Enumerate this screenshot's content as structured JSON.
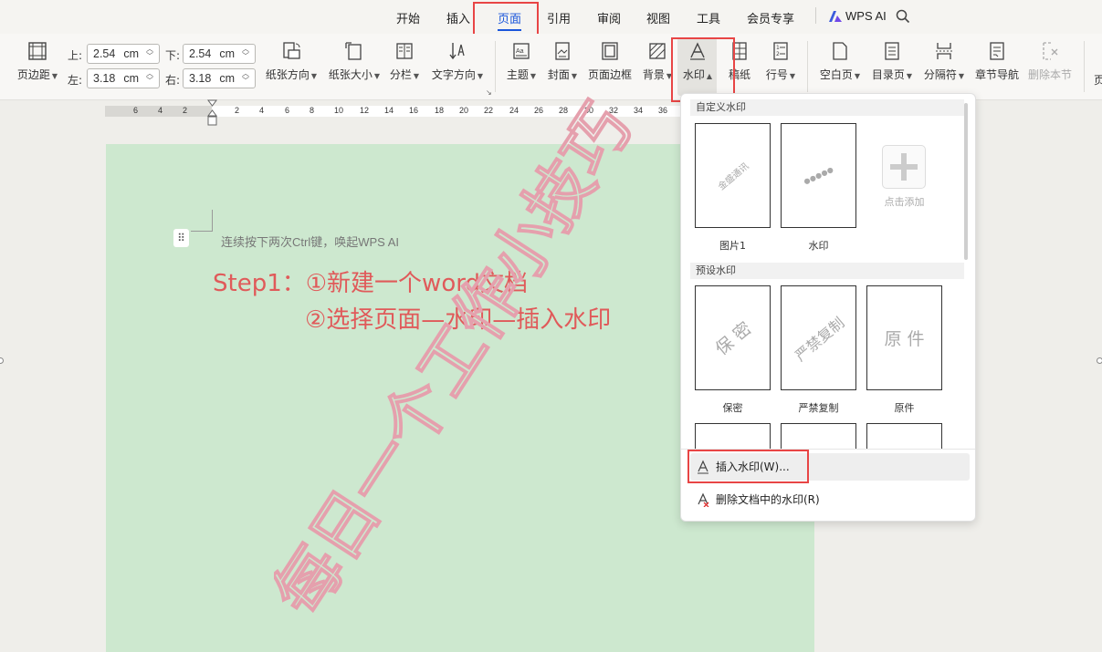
{
  "menubar": {
    "tabs": [
      {
        "label": "开始"
      },
      {
        "label": "插入"
      },
      {
        "label": "页面"
      },
      {
        "label": "引用"
      },
      {
        "label": "审阅"
      },
      {
        "label": "视图"
      },
      {
        "label": "工具"
      },
      {
        "label": "会员专享"
      }
    ],
    "active_tab": "页面",
    "wps_ai": "WPS AI"
  },
  "ribbon": {
    "margins_label": "页边距",
    "top_label": "上:",
    "top_value": "2.54",
    "bottom_label": "下:",
    "bottom_value": "2.54",
    "left_label": "左:",
    "left_value": "3.18",
    "right_label": "右:",
    "right_value": "3.18",
    "unit": "cm",
    "orientation": "纸张方向",
    "size": "纸张大小",
    "columns": "分栏",
    "text_direction": "文字方向",
    "theme": "主题",
    "cover": "封面",
    "page_border": "页面边框",
    "background": "背景",
    "watermark": "水印",
    "manuscript": "稿纸",
    "line_number": "行号",
    "blank_page": "空白页",
    "toc_page": "目录页",
    "separator": "分隔符",
    "chapter_nav": "章节导航",
    "delete_section": "删除本节",
    "more_cut": "页"
  },
  "ruler": {
    "numbers": [
      "6",
      "4",
      "2",
      "2",
      "4",
      "6",
      "8",
      "10",
      "12",
      "14",
      "16",
      "18",
      "20",
      "22",
      "24",
      "26",
      "28",
      "30",
      "32",
      "34",
      "36"
    ]
  },
  "document": {
    "hint": "连续按下两次Ctrl键，唤起WPS AI",
    "annotation_line1": "Step1：①新建一个word文档",
    "annotation_line2": "②选择页面—水印—插入水印"
  },
  "watermark_panel": {
    "custom_header": "自定义水印",
    "custom_items": [
      {
        "label": "图片1",
        "thumb_text": "金盛通讯"
      },
      {
        "label": "水印",
        "thumb_text": "●●●●●"
      }
    ],
    "add_label": "点击添加",
    "preset_header": "预设水印",
    "preset_items": [
      {
        "label": "保密",
        "thumb_text": "保 密"
      },
      {
        "label": "严禁复制",
        "thumb_text": "严禁复制"
      },
      {
        "label": "原件",
        "thumb_text": "原 件"
      }
    ],
    "insert_label": "插入水印(W)...",
    "delete_label": "删除文档中的水印(R)"
  },
  "overlay_watermark": "每日一个工作小技巧",
  "colors": {
    "accent": "#1a56db",
    "highlight": "#e84545",
    "doc_bg": "#cde8cf",
    "annotation": "#e05a5a"
  }
}
